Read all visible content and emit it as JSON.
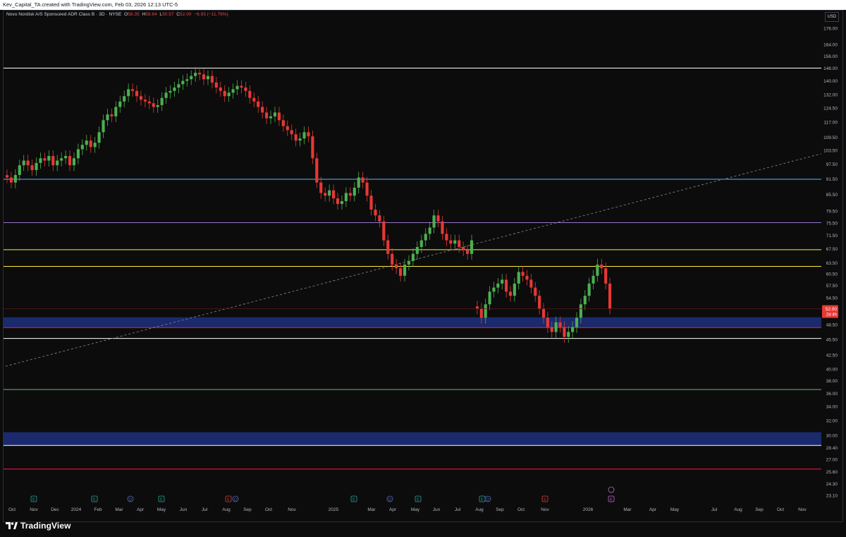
{
  "header": {
    "credit": "Kev_Capital_TA created with TradingView.com, Feb 03, 2026 12:13 UTC-5"
  },
  "legend": {
    "symbol": "Novo Nordisk A/S Sponsored ADR Class B · 3D · NYSE",
    "o_label": "O",
    "o_value": "58.35",
    "h_label": "H",
    "h_value": "58.64",
    "l_label": "L",
    "l_value": "50.57",
    "c_label": "C",
    "c_value": "52.00",
    "change": "−6.93 (−11.76%)"
  },
  "currency_button": "USD",
  "branding": {
    "name": "TradingView"
  },
  "colors": {
    "background": "#0c0c0c",
    "up_candle": "#26a69a",
    "up_candle_chart": "#4caf50",
    "down_candle": "#e53935",
    "axis_text": "#b2b5be",
    "price_tag_bg": "#e53935"
  },
  "chart_data": {
    "type": "candlestick",
    "symbol": "NVO",
    "interval": "3D",
    "y_axis": {
      "scale": "log",
      "ticks": [
        "176.00",
        "164.00",
        "156.00",
        "148.00",
        "140.00",
        "132.00",
        "124.50",
        "117.00",
        "109.50",
        "103.50",
        "97.50",
        "91.50",
        "85.50",
        "79.50",
        "75.50",
        "71.50",
        "67.50",
        "63.50",
        "60.50",
        "57.50",
        "54.50",
        "50.50",
        "48.50",
        "45.50",
        "42.50",
        "40.00",
        "38.00",
        "36.00",
        "34.00",
        "32.00",
        "30.00",
        "28.40",
        "27.00",
        "25.60",
        "24.30",
        "23.10"
      ]
    },
    "x_axis": {
      "ticks": [
        "Oct",
        "Nov",
        "Dec",
        "2024",
        "Feb",
        "Mar",
        "Apr",
        "May",
        "Jun",
        "Jul",
        "Aug",
        "Sep",
        "Oct",
        "Nov",
        "2025",
        "Mar",
        "Apr",
        "May",
        "Jun",
        "Jul",
        "Aug",
        "Sep",
        "Oct",
        "Nov",
        "2026",
        "Mar",
        "Apr",
        "May",
        "Jul",
        "Aug",
        "Sep",
        "Oct",
        "Nov"
      ]
    },
    "last_price": {
      "value": "52.00",
      "countdown": "2d 4h"
    },
    "horizontal_levels": [
      {
        "price": 148.0,
        "color": "#ffffff"
      },
      {
        "price": 91.3,
        "color": "#64b5f6"
      },
      {
        "price": 75.6,
        "color": "#9575cd"
      },
      {
        "price": 67.2,
        "color": "#ffeb3b"
      },
      {
        "price": 62.5,
        "color": "#ffeb3b"
      },
      {
        "price": 47.9,
        "color": "#ff1744"
      },
      {
        "price": 45.7,
        "color": "#ffffff"
      },
      {
        "price": 36.6,
        "color": "#66bb6a"
      },
      {
        "price": 28.7,
        "color": "#ffffff"
      },
      {
        "price": 25.9,
        "color": "#ff1744"
      }
    ],
    "zones": [
      {
        "from": 47.9,
        "to": 50.1,
        "color": "#1a2a6c"
      },
      {
        "from": 28.7,
        "to": 30.4,
        "color": "#1a2a6c"
      }
    ],
    "trendline": {
      "style": "dashed",
      "color": "#8a8d95",
      "from": {
        "date": "2023-10",
        "price": 40.5
      },
      "to": {
        "date": "2026-11",
        "price": 102.0
      }
    },
    "series_close": [
      92,
      90,
      93,
      97,
      99,
      97,
      95,
      98,
      100,
      99,
      101,
      97,
      99,
      100,
      101,
      97,
      100,
      104,
      106,
      108,
      105,
      107,
      112,
      118,
      121,
      120,
      125,
      128,
      131,
      135,
      134,
      131,
      129,
      128,
      127,
      125,
      126,
      130,
      133,
      134,
      136,
      138,
      140,
      141,
      143,
      145,
      144,
      141,
      143,
      139,
      136,
      134,
      131,
      133,
      135,
      137,
      136,
      134,
      130,
      128,
      125,
      122,
      119,
      120,
      122,
      118,
      115,
      113,
      111,
      108,
      109,
      112,
      110,
      100,
      90,
      86,
      85,
      87,
      84,
      82,
      83,
      86,
      85,
      88,
      92,
      90,
      85,
      80,
      78,
      76,
      70,
      66,
      63,
      62,
      60,
      63,
      64,
      66,
      68,
      70,
      72,
      74,
      78,
      76,
      72,
      70,
      69,
      70,
      68,
      67,
      66,
      70,
      52,
      50,
      53,
      56,
      57,
      58,
      59,
      56,
      55,
      58,
      61,
      60,
      59,
      57,
      55,
      52,
      50,
      48,
      47,
      49,
      48,
      46,
      47,
      48,
      50,
      53,
      55,
      58,
      60,
      63,
      62,
      58,
      52
    ],
    "earnings_markers": [
      "E",
      "E",
      "D",
      "E",
      "E",
      "D",
      "E",
      "E",
      "D",
      "E",
      "E D",
      "E",
      "E",
      "E",
      "E"
    ]
  }
}
